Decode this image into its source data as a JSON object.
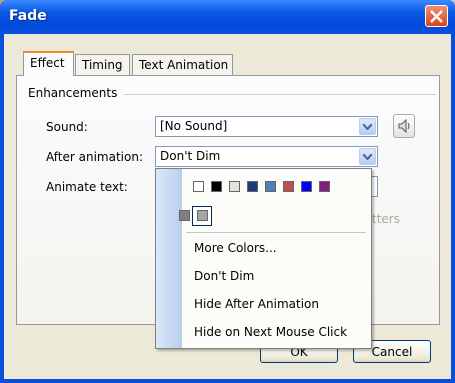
{
  "window": {
    "title": "Fade"
  },
  "tabs": [
    {
      "label": "Effect"
    },
    {
      "label": "Timing"
    },
    {
      "label": "Text Animation"
    }
  ],
  "group": {
    "label": "Enhancements"
  },
  "fields": {
    "sound": {
      "label": "Sound:",
      "value": "[No Sound]"
    },
    "after_animation": {
      "label": "After animation:",
      "value": "Don't Dim"
    },
    "animate_text": {
      "label": "Animate text:",
      "partial_hint": "tters"
    }
  },
  "dropdown": {
    "colors_row1": [
      "#ffffff",
      "#000000",
      "#e7e3d6",
      "#1f3a7a",
      "#4f81bd",
      "#c0504d",
      "#0000ff",
      "#7f1f7f"
    ],
    "colors_row2": [
      "#7f7f7f",
      "#a6a6a6"
    ],
    "more_colors": "More Colors...",
    "dont_dim": "Don't Dim",
    "hide_after": "Hide After Animation",
    "hide_next_click": "Hide on Next Mouse Click"
  },
  "buttons": {
    "ok": "OK",
    "cancel": "Cancel"
  },
  "icons": [
    "close-icon",
    "speaker-icon",
    "chevron-down-icon"
  ]
}
